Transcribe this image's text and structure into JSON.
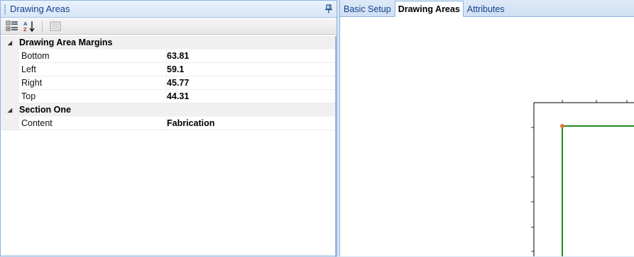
{
  "left_panel": {
    "title": "Drawing Areas"
  },
  "toolbar": {
    "icons": [
      "categorized-icon",
      "alphabetical-sort-icon",
      "property-pages-icon"
    ]
  },
  "categories": [
    {
      "name": "Drawing Area Margins",
      "properties": [
        {
          "name": "Bottom",
          "value": "63.81"
        },
        {
          "name": "Left",
          "value": "59.1"
        },
        {
          "name": "Right",
          "value": "45.77"
        },
        {
          "name": "Top",
          "value": "44.31"
        }
      ]
    },
    {
      "name": "Section One",
      "properties": [
        {
          "name": "Content",
          "value": "Fabrication"
        }
      ]
    }
  ],
  "tabs": [
    {
      "label": "Basic Setup",
      "active": false
    },
    {
      "label": "Drawing Areas",
      "active": true
    },
    {
      "label": "Attributes",
      "active": false
    }
  ],
  "colors": {
    "area_outline": "#1f8a1f",
    "corner_marker": "#e0763a",
    "ruler": "#000000"
  }
}
